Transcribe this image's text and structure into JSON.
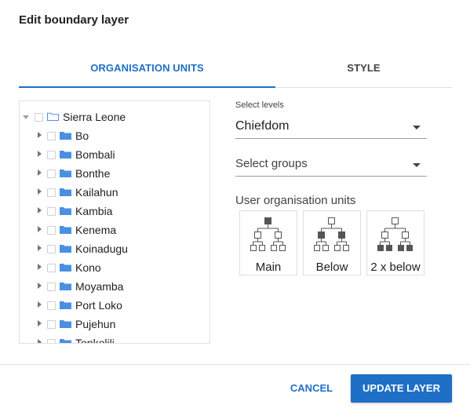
{
  "dialog": {
    "title": "Edit boundary layer"
  },
  "tabs": [
    {
      "label": "ORGANISATION UNITS",
      "active": true
    },
    {
      "label": "STYLE",
      "active": false
    }
  ],
  "tree": {
    "root": {
      "label": "Sierra Leone",
      "icon": "folder-open-icon"
    },
    "items": [
      {
        "label": "Bo"
      },
      {
        "label": "Bombali"
      },
      {
        "label": "Bonthe"
      },
      {
        "label": "Kailahun"
      },
      {
        "label": "Kambia"
      },
      {
        "label": "Kenema"
      },
      {
        "label": "Koinadugu"
      },
      {
        "label": "Kono"
      },
      {
        "label": "Moyamba"
      },
      {
        "label": "Port Loko"
      },
      {
        "label": "Pujehun"
      },
      {
        "label": "Tonkolili"
      }
    ]
  },
  "levels": {
    "label": "Select levels",
    "value": "Chiefdom"
  },
  "groups": {
    "placeholder": "Select groups"
  },
  "user_org_units": {
    "label": "User organisation units",
    "buttons": [
      {
        "label": "Main",
        "icon": "hierarchy-main-icon"
      },
      {
        "label": "Below",
        "icon": "hierarchy-below-icon"
      },
      {
        "label": "2 x below",
        "icon": "hierarchy-2-below-icon"
      }
    ]
  },
  "actions": {
    "cancel": "CANCEL",
    "update": "UPDATE LAYER"
  },
  "colors": {
    "accent": "#1e6fc6",
    "folder": "#4a90e2",
    "filled_node": "#555555"
  }
}
